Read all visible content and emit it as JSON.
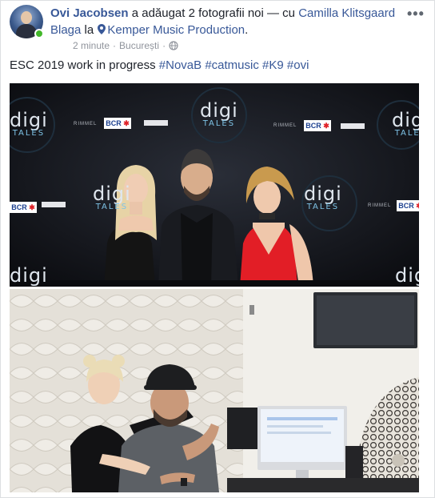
{
  "header": {
    "author": "Ovi Jacobsen",
    "action": " a adăugat 2 fotografii noi — cu ",
    "tagged": "Camilla Klitsgaard Blaga",
    "at": " la ",
    "location": "Kemper Music Production",
    "after_location": ".",
    "time": "2 minute",
    "separator": "·",
    "city": "București",
    "sep2": "·",
    "more": "•••"
  },
  "post": {
    "text_prefix": "ESC 2019 work in progress ",
    "hashtags": [
      "#NovaB",
      "#catmusic",
      "#K9",
      "#ovi"
    ]
  },
  "photos": {
    "photo1": {
      "logo_word": "digi",
      "logo_sub": "TALES",
      "sponsor_brand": "BCR",
      "sponsor_mark": "✱",
      "sponsor_name": "RIMMEL"
    }
  },
  "colors": {
    "link": "#385898",
    "meta": "#90949c",
    "online": "#42b72a"
  }
}
